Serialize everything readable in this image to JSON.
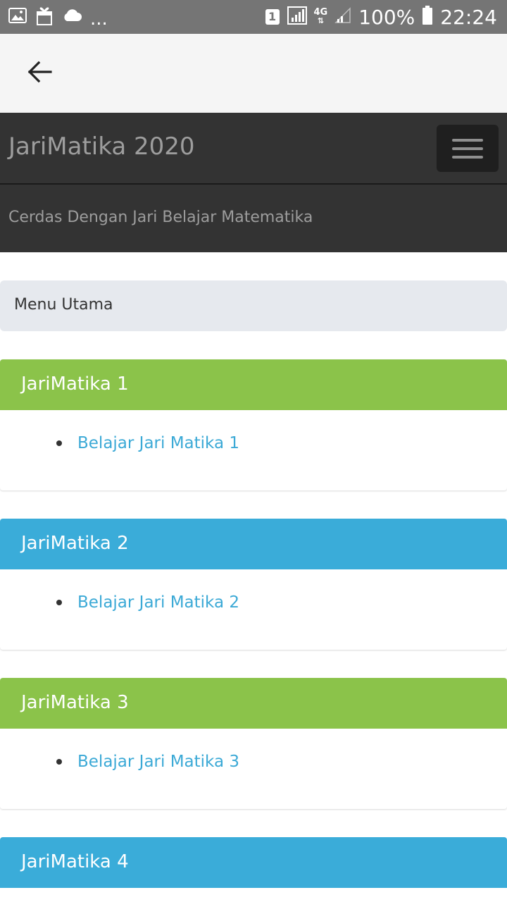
{
  "status_bar": {
    "battery": "100%",
    "time": "22:24",
    "sim_slot": "1",
    "network": "4G",
    "more": "...",
    "icons": [
      "image-icon",
      "gif-icon",
      "cloud-icon",
      "sim-icon",
      "signal-icon",
      "network-4g-icon",
      "signal-weak-icon",
      "battery-icon"
    ]
  },
  "appbar": {
    "back_icon": "arrow-left-icon"
  },
  "navbar": {
    "brand": "JariMatika 2020",
    "toggler_icon": "hamburger-menu-icon"
  },
  "tagline": "Cerdas Dengan Jari Belajar Matematika",
  "menu": {
    "label": "Menu Utama"
  },
  "colors": {
    "green": "#8bc34a",
    "blue": "#3aacd9",
    "link": "#3ba9d6",
    "navbar": "#333333"
  },
  "panels": [
    {
      "title": "JariMatika 1",
      "color": "#8bc34a",
      "link": "Belajar Jari Matika 1"
    },
    {
      "title": "JariMatika 2",
      "color": "#3aacd9",
      "link": "Belajar Jari Matika 2"
    },
    {
      "title": "JariMatika 3",
      "color": "#8bc34a",
      "link": "Belajar Jari Matika 3"
    },
    {
      "title": "JariMatika 4",
      "color": "#3aacd9",
      "link": ""
    }
  ]
}
